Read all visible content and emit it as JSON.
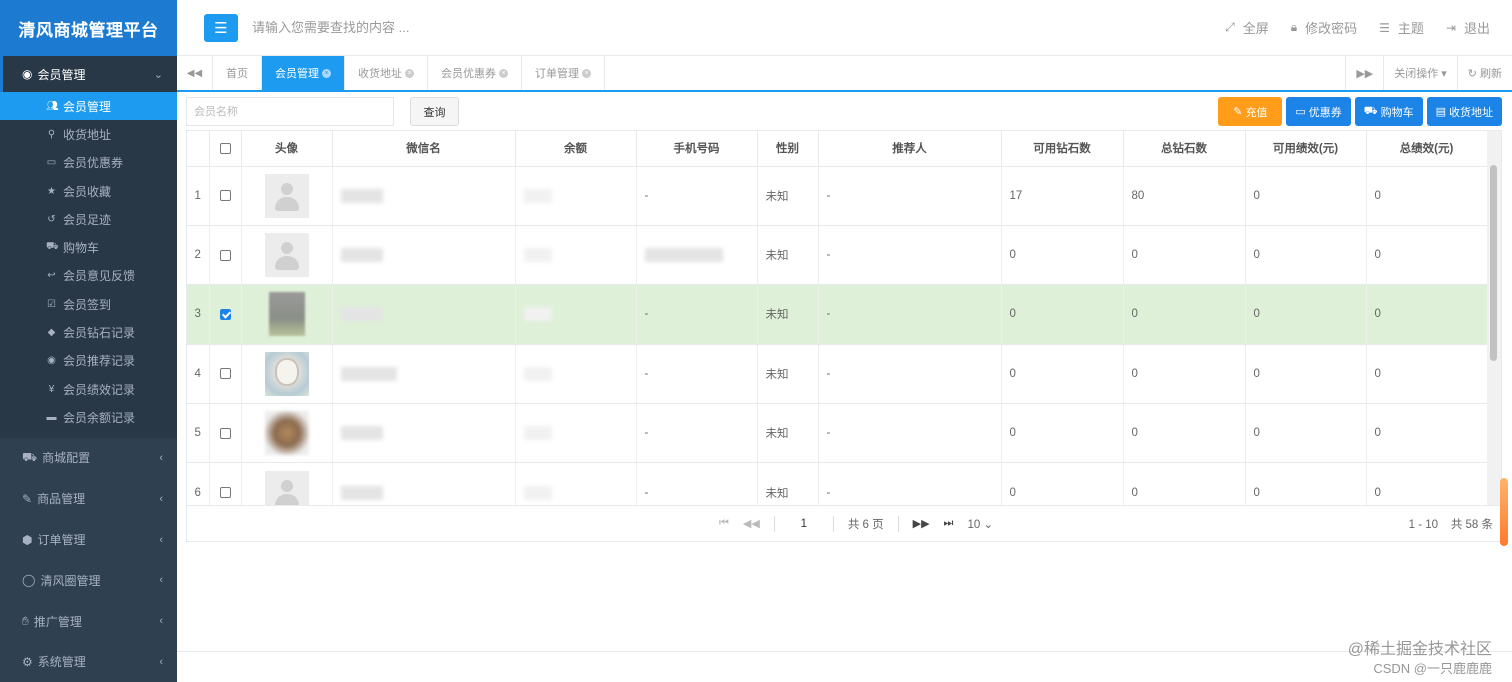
{
  "app": {
    "title": "清风商城管理平台"
  },
  "sidebar": {
    "open_group": {
      "label": "会员管理",
      "icon": "user-circle-icon"
    },
    "sub_items": [
      {
        "label": "会员管理",
        "icon": "users-icon",
        "active": true
      },
      {
        "label": "收货地址",
        "icon": "map-marker-icon",
        "active": false
      },
      {
        "label": "会员优惠券",
        "icon": "ticket-icon",
        "active": false
      },
      {
        "label": "会员收藏",
        "icon": "star-icon",
        "active": false
      },
      {
        "label": "会员足迹",
        "icon": "history-icon",
        "active": false
      },
      {
        "label": "购物车",
        "icon": "cart-icon",
        "active": false
      },
      {
        "label": "会员意见反馈",
        "icon": "reply-icon",
        "active": false
      },
      {
        "label": "会员签到",
        "icon": "check-square-icon",
        "active": false
      },
      {
        "label": "会员钻石记录",
        "icon": "diamond-icon",
        "active": false
      },
      {
        "label": "会员推荐记录",
        "icon": "user-circle-icon",
        "active": false
      },
      {
        "label": "会员绩效记录",
        "icon": "yen-icon",
        "active": false
      },
      {
        "label": "会员余额记录",
        "icon": "credit-card-icon",
        "active": false
      }
    ],
    "groups": [
      {
        "label": "商城配置",
        "icon": "cart-icon"
      },
      {
        "label": "商品管理",
        "icon": "edit-icon"
      },
      {
        "label": "订单管理",
        "icon": "cube-icon"
      },
      {
        "label": "清风圈管理",
        "icon": "comment-icon"
      },
      {
        "label": "推广管理",
        "icon": "hand-icon"
      },
      {
        "label": "系统管理",
        "icon": "gear-icon"
      }
    ]
  },
  "header": {
    "search_placeholder": "请输入您需要查找的内容 ...",
    "fullscreen": "全屏",
    "change_password": "修改密码",
    "theme": "主题",
    "logout": "退出"
  },
  "tabs": {
    "items": [
      {
        "label": "首页",
        "active": false,
        "closable": false
      },
      {
        "label": "会员管理",
        "active": true,
        "closable": true
      },
      {
        "label": "收货地址",
        "active": false,
        "closable": true
      },
      {
        "label": "会员优惠券",
        "active": false,
        "closable": true
      },
      {
        "label": "订单管理",
        "active": false,
        "closable": true
      }
    ],
    "close_ops": "关闭操作",
    "refresh": "刷新"
  },
  "toolbar": {
    "member_name_placeholder": "会员名称",
    "query": "查询",
    "recharge": "充值",
    "coupon": "优惠券",
    "cart": "购物车",
    "address": "收货地址"
  },
  "table": {
    "columns": [
      "头像",
      "微信名",
      "余额",
      "手机号码",
      "性别",
      "推荐人",
      "可用钻石数",
      "总钻石数",
      "可用绩效(元)",
      "总绩效(元)"
    ],
    "rows": [
      {
        "index": "1",
        "checked": false,
        "avatar": "default",
        "phone": "-",
        "gender": "未知",
        "referrer": "-",
        "avail_diamond": "17",
        "total_diamond": "80",
        "avail_perf": "0",
        "total_perf": "0"
      },
      {
        "index": "2",
        "checked": false,
        "avatar": "default",
        "phone": "",
        "gender": "未知",
        "referrer": "-",
        "avail_diamond": "0",
        "total_diamond": "0",
        "avail_perf": "0",
        "total_perf": "0"
      },
      {
        "index": "3",
        "checked": true,
        "avatar": "blur1",
        "phone": "-",
        "gender": "未知",
        "referrer": "-",
        "avail_diamond": "0",
        "total_diamond": "0",
        "avail_perf": "0",
        "total_perf": "0"
      },
      {
        "index": "4",
        "checked": false,
        "avatar": "cat",
        "phone": "-",
        "gender": "未知",
        "referrer": "-",
        "avail_diamond": "0",
        "total_diamond": "0",
        "avail_perf": "0",
        "total_perf": "0"
      },
      {
        "index": "5",
        "checked": false,
        "avatar": "blur2",
        "phone": "-",
        "gender": "未知",
        "referrer": "-",
        "avail_diamond": "0",
        "total_diamond": "0",
        "avail_perf": "0",
        "total_perf": "0"
      },
      {
        "index": "6",
        "checked": false,
        "avatar": "default",
        "phone": "-",
        "gender": "未知",
        "referrer": "-",
        "avail_diamond": "0",
        "total_diamond": "0",
        "avail_perf": "0",
        "total_perf": "0"
      }
    ]
  },
  "pagination": {
    "current_page": "1",
    "total_pages": "共 6 页",
    "page_size": "10",
    "range": "1 - 10",
    "total": "共 58 条"
  },
  "watermark": {
    "line1": "@稀土掘金技术社区",
    "line2": "CSDN @一只鹿鹿鹿"
  },
  "colors": {
    "sidebar_bg": "#2f4050",
    "accent": "#1c9bf0",
    "selected_row": "#dff0d8",
    "recharge": "#ff9c1a",
    "button_blue": "#1c84e6"
  }
}
